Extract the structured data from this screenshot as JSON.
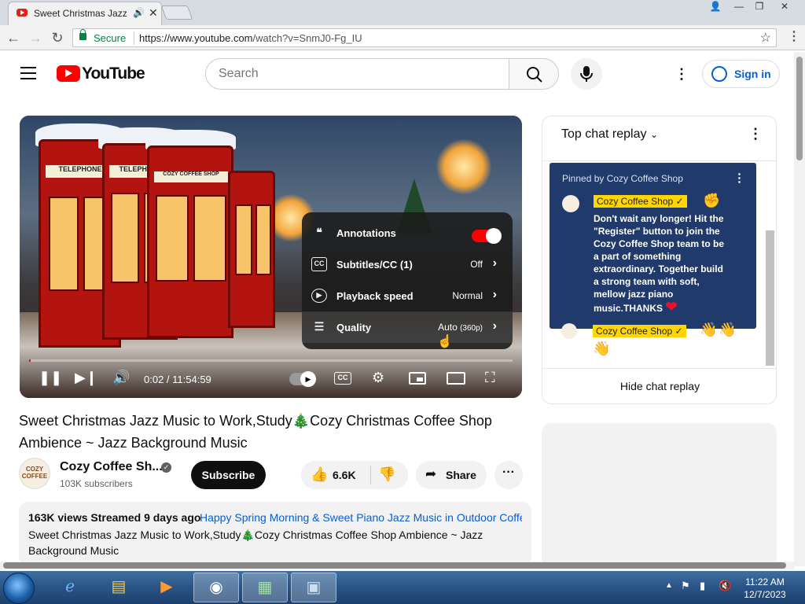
{
  "browser": {
    "tab_title": "Sweet Christmas Jazz",
    "secure_label": "Secure",
    "url_host": "https://www.youtube.com",
    "url_path": "/watch?v=SnmJ0-Fg_IU"
  },
  "header": {
    "logo_text": "YouTube",
    "search_placeholder": "Search",
    "signin_label": "Sign in"
  },
  "player": {
    "booth_sign_1": "TELEPHONE",
    "booth_sign_2": "TELEPHONE",
    "booth_sign_3": "COZY COFFEE SHOP",
    "settings": [
      {
        "label": "Annotations",
        "value": ""
      },
      {
        "label": "Subtitles/CC (1)",
        "value": "Off"
      },
      {
        "label": "Playback speed",
        "value": "Normal"
      },
      {
        "label": "Quality",
        "value": "Auto",
        "value_suffix": "(360p)"
      }
    ],
    "annotations_on": true,
    "time": "0:02 / 11:54:59",
    "progress": 0.0
  },
  "video": {
    "title": "Sweet Christmas Jazz Music to Work,Study🎄Cozy Christmas Coffee Shop Ambience ~ Jazz Background Music",
    "channel_name": "Cozy Coffee Sh...",
    "subscribers": "103K subscribers",
    "subscribe_label": "Subscribe",
    "likes": "6.6K",
    "share_label": "Share",
    "avatar_text": "COZY COFFEE"
  },
  "description": {
    "meta": "163K views  Streamed 9 days ago",
    "related_tag": "Happy Spring Morning & Sweet Piano Jazz Music in Outdoor Coffee",
    "body": "Sweet Christmas Jazz Music to Work,Study🎄Cozy Christmas Coffee Shop Ambience ~ Jazz Background Music"
  },
  "chat": {
    "header": "Top chat replay",
    "pinned_by": "Pinned by Cozy Coffee Shop",
    "pinned_author": "Cozy Coffee Shop ✓",
    "pinned_emoji": "✊",
    "pinned_message": "Don't wait any longer! Hit the \"Register\" button to join the Cozy Coffee Shop team to be a part of something extraordinary. Together build a strong team with soft, mellow jazz piano music.THANKS",
    "second_author": "Cozy Coffee Shop ✓",
    "second_emoji": "👋👋",
    "second_emoji_2": "👋",
    "hide_label": "Hide chat replay"
  },
  "taskbar": {
    "time": "11:22 AM",
    "date": "12/7/2023"
  }
}
